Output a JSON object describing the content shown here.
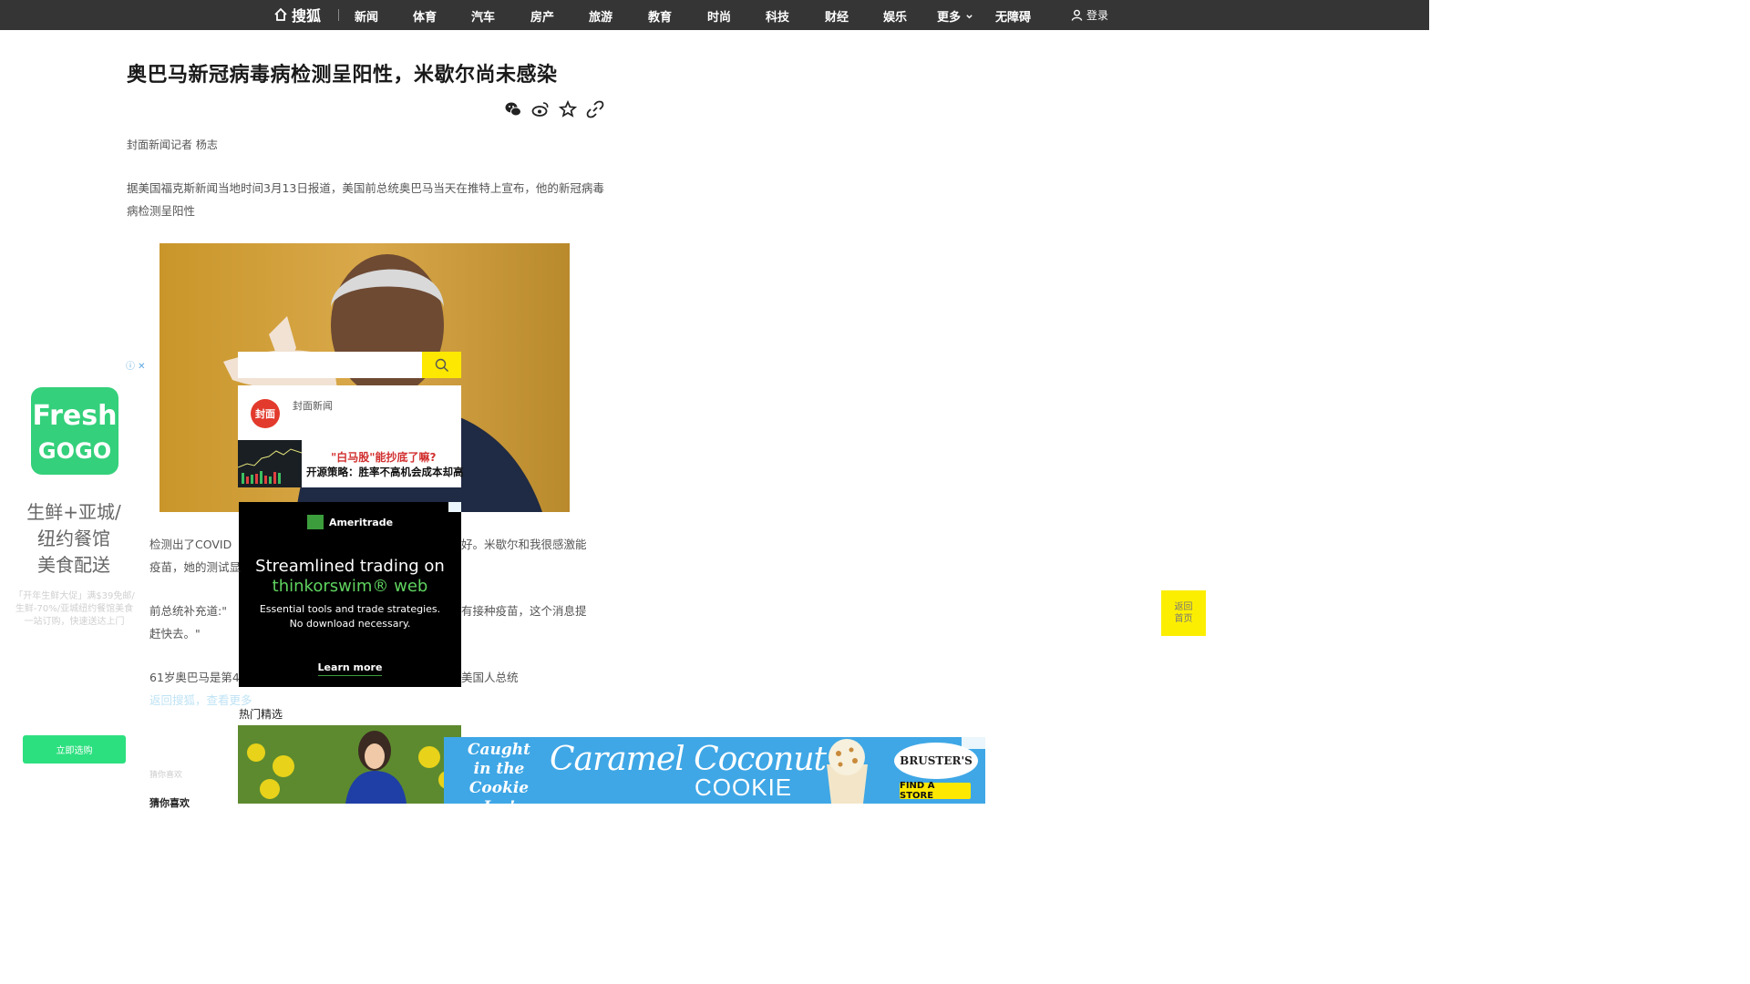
{
  "nav": {
    "logo_text": "搜狐",
    "items": [
      "新闻",
      "体育",
      "汽车",
      "房产",
      "旅游",
      "教育",
      "时尚",
      "科技",
      "财经",
      "娱乐",
      "更多",
      "无障碍"
    ],
    "login": "登录",
    "bg_color": "#353535"
  },
  "article": {
    "title": "奥巴马新冠病毒病检测呈阳性，米歇尔尚未感染",
    "byline": "封面新闻记者 杨志",
    "paragraph1": "据美国福克斯新闻当地时间3月13日报道，美国前总统奥巴马当天在推特上宣布，他的新冠病毒病检测呈阳性",
    "paragraph2_a": "检测出了COVID",
    "paragraph2_b": "好。米歇尔和我很感激能",
    "paragraph2_c": "疫苗，她的测试显",
    "paragraph3_a": "前总统补充道:\"",
    "paragraph3_b": "有接种疫苗，这个消息提",
    "paragraph3_c": "赶快去。\"",
    "paragraph4_a": "61岁奥巴马是第4",
    "paragraph4_b": "美国人总统",
    "paragraph4_link": "返回搜狐，查看更多",
    "share_icons": [
      "wechat-icon",
      "weibo-icon",
      "favorite-icon",
      "link-icon"
    ]
  },
  "overlay": {
    "feed_source_badge": "封面",
    "feed_source": "封面新闻",
    "headline_red": "\"白马股\"能抄底了嘛?",
    "headline_black": "开源策略：胜率不高机会成本却高"
  },
  "ameritrade_ad": {
    "brand": "Ameritrade",
    "headline_line1": "Streamlined trading on",
    "headline_line2": "thinkorswim® web",
    "subtext_line1": "Essential tools and trade strategies.",
    "subtext_line2": "No download necessary.",
    "cta": "Learn more"
  },
  "left_ad": {
    "logo_line1": "Fresh",
    "logo_line2": "GOGO",
    "tagline_line1": "生鲜+亚城/",
    "tagline_line2": "纽约餐馆",
    "tagline_line3": "美食配送",
    "desc": "「开年生鲜大促」满$39免邮/生鲜-70%/亚城纽约餐馆美食一站订购，快速送达上门",
    "button": "立即选购",
    "accent": "#2de07f"
  },
  "back_home": {
    "line1": "返回",
    "line2": "首页"
  },
  "hot": {
    "label": "热门精选",
    "left_small": "猜你喜欢",
    "left_bold": "猜你喜欢"
  },
  "cookie_ad": {
    "caught_line1": "Caught",
    "caught_line2": "in the",
    "caught_line3": "Cookie Jar!",
    "title": "Caramel Coconut",
    "word": "COOKIE",
    "brand": "BRUSTER'S",
    "cta": "FIND A STORE"
  }
}
